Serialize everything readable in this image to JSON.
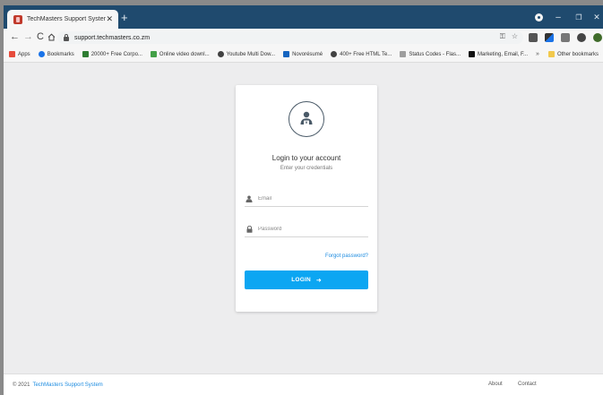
{
  "browser": {
    "tab_title": "TechMasters Support System",
    "url": "support.techmasters.co.zm",
    "bookmarks": [
      {
        "label": "Apps",
        "color": "#e74c3c"
      },
      {
        "label": "Bookmarks",
        "color": "#1a73e8"
      },
      {
        "label": "20000+ Free Corpo...",
        "color": "#2e7d32"
      },
      {
        "label": "Online video downl...",
        "color": "#43a047"
      },
      {
        "label": "Youtube Multi Dow...",
        "color": "#424242"
      },
      {
        "label": "Novorésumé",
        "color": "#1565c0"
      },
      {
        "label": "400+ Free HTML Te...",
        "color": "#424242"
      },
      {
        "label": "Status Codes - Flas...",
        "color": "#9e9e9e"
      },
      {
        "label": "Marketing, Email, F...",
        "color": "#111111"
      }
    ],
    "bookmarks_overflow": "»",
    "other_bookmarks": "Other bookmarks"
  },
  "login": {
    "title": "Login to your account",
    "subtitle": "Enter your credentials",
    "email_placeholder": "Email",
    "password_placeholder": "Password",
    "forgot_label": "Forgot password?",
    "login_label": "LOGIN"
  },
  "footer": {
    "copyright": "© 2021",
    "brand": "TechMasters Support System",
    "about": "About",
    "contact": "Contact"
  },
  "colors": {
    "tab_strip": "#1f4a6e",
    "accent": "#0ca6f2",
    "link": "#1d8ce0"
  }
}
